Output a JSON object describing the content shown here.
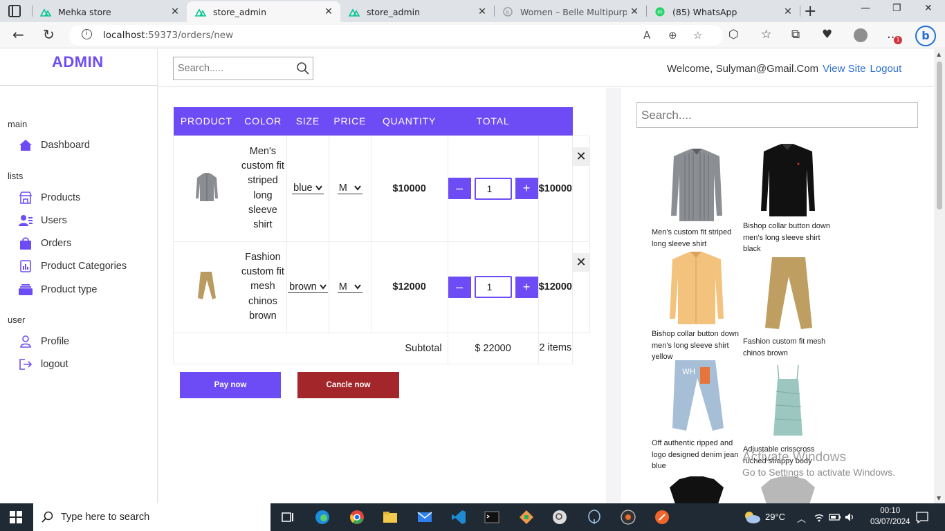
{
  "browser": {
    "tabs": [
      {
        "label": "Mehka store",
        "active": false
      },
      {
        "label": "store_admin",
        "active": true
      },
      {
        "label": "store_admin",
        "active": false
      },
      {
        "label": "Women – Belle Multipurpose",
        "active": false
      },
      {
        "label": "(85) WhatsApp",
        "active": false
      }
    ],
    "whatsapp_badge": "85",
    "url_host": "localhost",
    "url_rest": ":59373/orders/new",
    "notification_count": "1"
  },
  "sidebar": {
    "logo": "ADMIN",
    "sections": [
      {
        "title": "main",
        "items": [
          {
            "label": "Dashboard",
            "icon": "home-icon"
          }
        ]
      },
      {
        "title": "lists",
        "items": [
          {
            "label": "Products",
            "icon": "store-icon"
          },
          {
            "label": "Users",
            "icon": "users-icon"
          },
          {
            "label": "Orders",
            "icon": "bag-icon"
          },
          {
            "label": "Product Categories",
            "icon": "chart-icon"
          },
          {
            "label": "Product type",
            "icon": "layers-icon"
          }
        ]
      },
      {
        "title": "user",
        "items": [
          {
            "label": "Profile",
            "icon": "person-icon"
          },
          {
            "label": "logout",
            "icon": "logout-icon"
          }
        ]
      }
    ]
  },
  "header": {
    "search_placeholder": "Search.....",
    "welcome": "Welcome, Sulyman@Gmail.Com",
    "view_site": "View Site",
    "logout": "Logout"
  },
  "order": {
    "columns": [
      "PRODUCT",
      "COLOR",
      "SIZE",
      "PRICE",
      "QUANTITY",
      "TOTAL"
    ],
    "rows": [
      {
        "name": "Men's custom fit striped long sleeve shirt",
        "color": "blue",
        "size": "M",
        "price": "$10000",
        "qty": "1",
        "total": "$10000"
      },
      {
        "name": "Fashion custom fit mesh chinos brown",
        "color": "brown",
        "size": "M",
        "price": "$12000",
        "qty": "1",
        "total": "$12000"
      }
    ],
    "minus_label": "–",
    "plus_label": "+",
    "remove_label": "✕",
    "subtotal_label": "Subtotal",
    "subtotal_value": "$ 22000",
    "items_count": "2 items",
    "pay_label": "Pay now",
    "cancel_label": "Cancle now"
  },
  "products_panel": {
    "search_placeholder": "Search....",
    "items": [
      {
        "name": "Men's custom fit striped long sleeve shirt"
      },
      {
        "name": "Bishop collar button down men's long sleeve shirt black"
      },
      {
        "name": "Bishop collar button down men's long sleeve shirt yellow"
      },
      {
        "name": "Fashion custom fit mesh chinos brown"
      },
      {
        "name": "Off authentic ripped and logo designed denim jean blue"
      },
      {
        "name": "Adjustable crisscross ruched strappy body"
      }
    ]
  },
  "watermark": {
    "line1": "Activate Windows",
    "line2": "Go to Settings to activate Windows."
  },
  "taskbar": {
    "search_placeholder": "Type here to search",
    "temperature": "29°C",
    "time": "00:10",
    "date": "03/07/2024"
  },
  "colors": {
    "accent": "#6d4cf6",
    "cancel": "#a2262a",
    "link": "#2f6fd1"
  }
}
